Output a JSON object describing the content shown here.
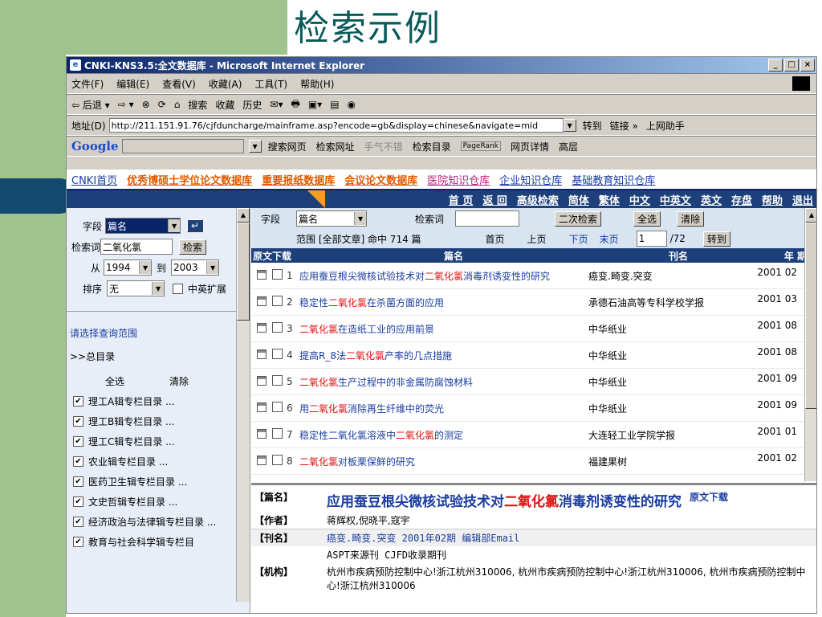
{
  "slide": {
    "title": "检索示例"
  },
  "window": {
    "title": "CNKI-KNS3.5:全文数据库 - Microsoft Internet Explorer"
  },
  "menu": [
    "文件(F)",
    "编辑(E)",
    "查看(V)",
    "收藏(A)",
    "工具(T)",
    "帮助(H)"
  ],
  "toolbar": [
    "⇦ 后退 ▾",
    "⇨ ▾",
    "⊗",
    "⟳",
    "⌂",
    "搜索",
    "收藏",
    "历史",
    "✉▾",
    "🖶",
    "▣▾",
    "▤",
    "◉",
    "✎",
    "✂",
    "⚙",
    "⚙"
  ],
  "address": {
    "label": "地址(D)",
    "url": "http://211.151.91.76/cjfduncharge/mainframe.asp?encode=gb&display=chinese&navigate=mid",
    "go": "转到",
    "links": "链接 »",
    "helper": "上网助手"
  },
  "googlebar": {
    "logo": "Google",
    "items": [
      "搜索网页",
      "检索网址",
      "手气不错",
      "检索目录",
      "PageRank",
      "网页详情",
      "高层"
    ]
  },
  "nav1": [
    "CNKI首页",
    "优秀博硕士学位论文数据库",
    "重要报纸数据库",
    "会议论文数据库",
    "医院知识仓库",
    "企业知识仓库",
    "基础教育知识仓库"
  ],
  "nav2": [
    "首 页",
    "返 回",
    "高级检索",
    "简体",
    "繁体",
    "中文",
    "中英文",
    "英文",
    "存盘",
    "帮助",
    "退出"
  ],
  "left": {
    "field_label": "字段",
    "field_value": "篇名",
    "term_label": "检索词",
    "term_value": "二氧化氯",
    "search_btn": "检索",
    "from_label": "从",
    "from_value": "1994",
    "to_label": "到",
    "to_value": "2003",
    "sort_label": "排序",
    "sort_value": "无",
    "expand_label": "中英扩展",
    "scope_prompt": "请选择查询范围",
    "catalog": ">>总目录",
    "select_all": "全选",
    "clear": "清除",
    "categories": [
      "理工A辑专栏目录 ...",
      "理工B辑专栏目录 ...",
      "理工C辑专栏目录 ...",
      "农业辑专栏目录 ...",
      "医药卫生辑专栏目录 ...",
      "文史哲辑专栏目录 ...",
      "经济政治与法律辑专栏目录 ...",
      "教育与社会科学辑专栏目"
    ]
  },
  "right": {
    "field_label": "字段",
    "field_value": "篇名",
    "term_label": "检索词",
    "secondary": "二次检索",
    "select_all": "全选",
    "clear": "清除",
    "scope": "范围 [全部文章] 命中 714 篇",
    "first": "首页",
    "prev": "上页",
    "next": "下页",
    "last": "末页",
    "page": "1",
    "total": "/72",
    "goto": "转到",
    "headers": [
      "原文下载",
      "篇名",
      "刊名",
      "年 期"
    ],
    "rows": [
      {
        "n": "1",
        "pre": "应用蚕豆根尖微核试验技术对",
        "hl": "二氧化氯",
        "post": "消毒剂诱变性的研究",
        "journal": "癌变.畸变.突变",
        "date": "2001 02"
      },
      {
        "n": "2",
        "pre": "稳定性",
        "hl": "二氧化氯",
        "post": "在杀菌方面的应用",
        "journal": "承德石油高等专科学校学报",
        "date": "2001 03"
      },
      {
        "n": "3",
        "pre": "",
        "hl": "二氧化氯",
        "post": "在造纸工业的应用前景",
        "journal": "中华纸业",
        "date": "2001 08"
      },
      {
        "n": "4",
        "pre": "提高R_8法",
        "hl": "二氧化氯",
        "post": "产率的几点措施",
        "journal": "中华纸业",
        "date": "2001 08"
      },
      {
        "n": "5",
        "pre": "",
        "hl": "二氧化氯",
        "post": "生产过程中的非金属防腐蚀材料",
        "journal": "中华纸业",
        "date": "2001 09"
      },
      {
        "n": "6",
        "pre": "用",
        "hl": "二氧化氯",
        "post": "消除再生纤维中的荧光",
        "journal": "中华纸业",
        "date": "2001 09"
      },
      {
        "n": "7",
        "pre": "稳定性二氧化氯溶液中",
        "hl": "二氧化氯",
        "post": "的测定",
        "journal": "大连轻工业学院学报",
        "date": "2001 01"
      },
      {
        "n": "8",
        "pre": "",
        "hl": "二氧化氯",
        "post": "对板栗保鲜的研究",
        "journal": "福建果树",
        "date": "2001 02"
      }
    ]
  },
  "detail": {
    "title_label": "【篇名】",
    "title_pre": "应用蚕豆根尖微核试验技术对",
    "title_hl": "二氧化氯",
    "title_post": "消毒剂诱变性的研究",
    "download": "原文下载",
    "author_label": "【作者】",
    "authors": "蒋辉权,倪晓平,寇宇",
    "journal_label": "【刊名】",
    "journal": "癌变.畸变.突变 2001年02期 编辑部Email",
    "source": "ASPT来源刊  CJFD收录期刊",
    "org_label": "【机构】",
    "org": "杭州市疾病预防控制中心!浙江杭州310006, 杭州市疾病预防控制中心!浙江杭州310006, 杭州市疾病预防控制中心!浙江杭州310006"
  }
}
